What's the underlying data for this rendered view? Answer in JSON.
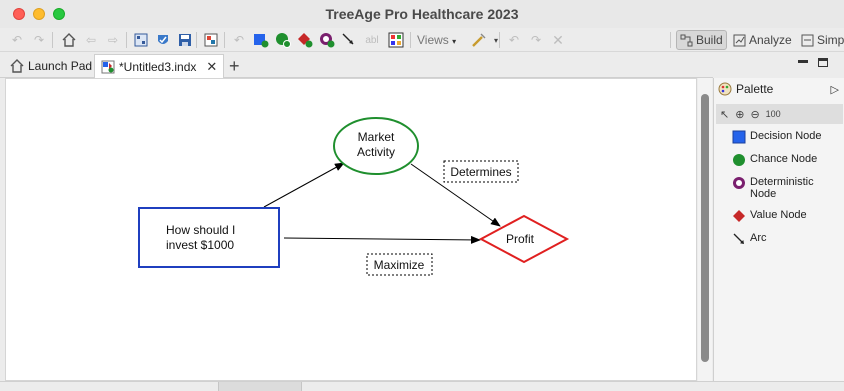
{
  "window": {
    "title": "TreeAge Pro Healthcare 2023"
  },
  "toolbar": {
    "views_label": "Views",
    "modes": [
      {
        "label": "Build",
        "active": true
      },
      {
        "label": "Analyze",
        "active": false
      },
      {
        "label": "Simp",
        "active": false
      }
    ]
  },
  "tabs": [
    {
      "label": "Launch Pad",
      "active": false
    },
    {
      "label": "*Untitled3.indx",
      "active": true
    }
  ],
  "palette": {
    "title": "Palette",
    "items": [
      {
        "label": "Decision Node",
        "icon": "decision-node-icon",
        "color": "#2563eb"
      },
      {
        "label": "Chance Node",
        "icon": "chance-node-icon",
        "color": "#1f8f2e"
      },
      {
        "label": "Deterministic Node",
        "icon": "deterministic-node-icon",
        "color": "#7a1f6e"
      },
      {
        "label": "Value Node",
        "icon": "value-node-icon",
        "color": "#c62828"
      },
      {
        "label": "Arc",
        "icon": "arc-icon",
        "color": "#222222"
      }
    ]
  },
  "diagram": {
    "decision_node": {
      "line1": "How should I",
      "line2": "invest $1000",
      "color": "#1f3fbf"
    },
    "chance_node": {
      "line1": "Market",
      "line2": "Activity",
      "color": "#1f8f2e"
    },
    "value_node": {
      "label": "Profit",
      "color": "#e02020"
    },
    "arc_labels": {
      "determines": "Determines",
      "maximize": "Maximize"
    }
  }
}
